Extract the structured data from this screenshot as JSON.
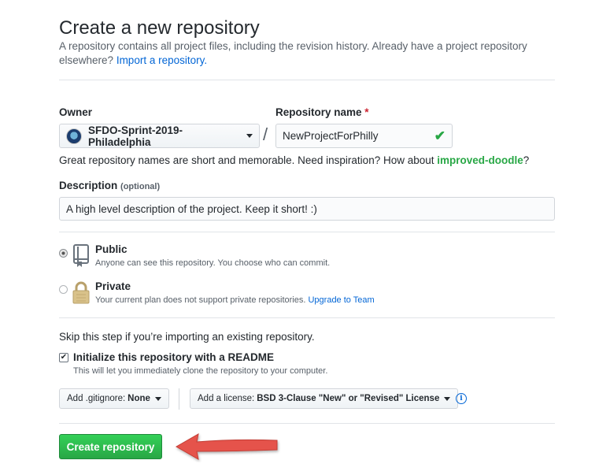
{
  "page": {
    "title": "Create a new repository",
    "subhead_text": "A repository contains all project files, including the revision history. Already have a project repository elsewhere?",
    "import_link": "Import a repository."
  },
  "owner": {
    "label": "Owner",
    "value": "SFDO-Sprint-2019-Philadelphia"
  },
  "repo_name": {
    "label": "Repository name",
    "required_mark": "*",
    "slash": "/",
    "value": "NewProjectForPhilly",
    "valid_mark": "✔"
  },
  "hint": {
    "text": "Great repository names are short and memorable. Need inspiration? How about",
    "suggestion": "improved-doodle",
    "end": "?"
  },
  "description": {
    "label": "Description",
    "optional": "(optional)",
    "value": "A high level description of the project. Keep it short! :)"
  },
  "visibility": {
    "public": {
      "title": "Public",
      "note": "Anyone can see this repository. You choose who can commit.",
      "selected": true
    },
    "private": {
      "title": "Private",
      "note": "Your current plan does not support private repositories.",
      "link": "Upgrade to Team",
      "selected": false
    }
  },
  "init": {
    "skip_text": "Skip this step if you’re importing an existing repository.",
    "readme_label": "Initialize this repository with a README",
    "readme_note": "This will let you immediately clone the repository to your computer.",
    "readme_checked": true,
    "check_glyph": "✔"
  },
  "gitignore": {
    "prefix": "Add .gitignore:",
    "value": "None"
  },
  "license": {
    "prefix": "Add a license:",
    "value": "BSD 3-Clause \"New\" or \"Revised\" License"
  },
  "info_glyph": "i",
  "submit": {
    "label": "Create repository"
  },
  "colors": {
    "link": "#0366d6",
    "success": "#28a745",
    "arrow": "#e5534b"
  },
  "icons": {
    "public": "repo-book-icon",
    "private": "lock-icon",
    "info": "info-icon",
    "valid": "check-icon",
    "annotation": "red-arrow-annotation"
  }
}
